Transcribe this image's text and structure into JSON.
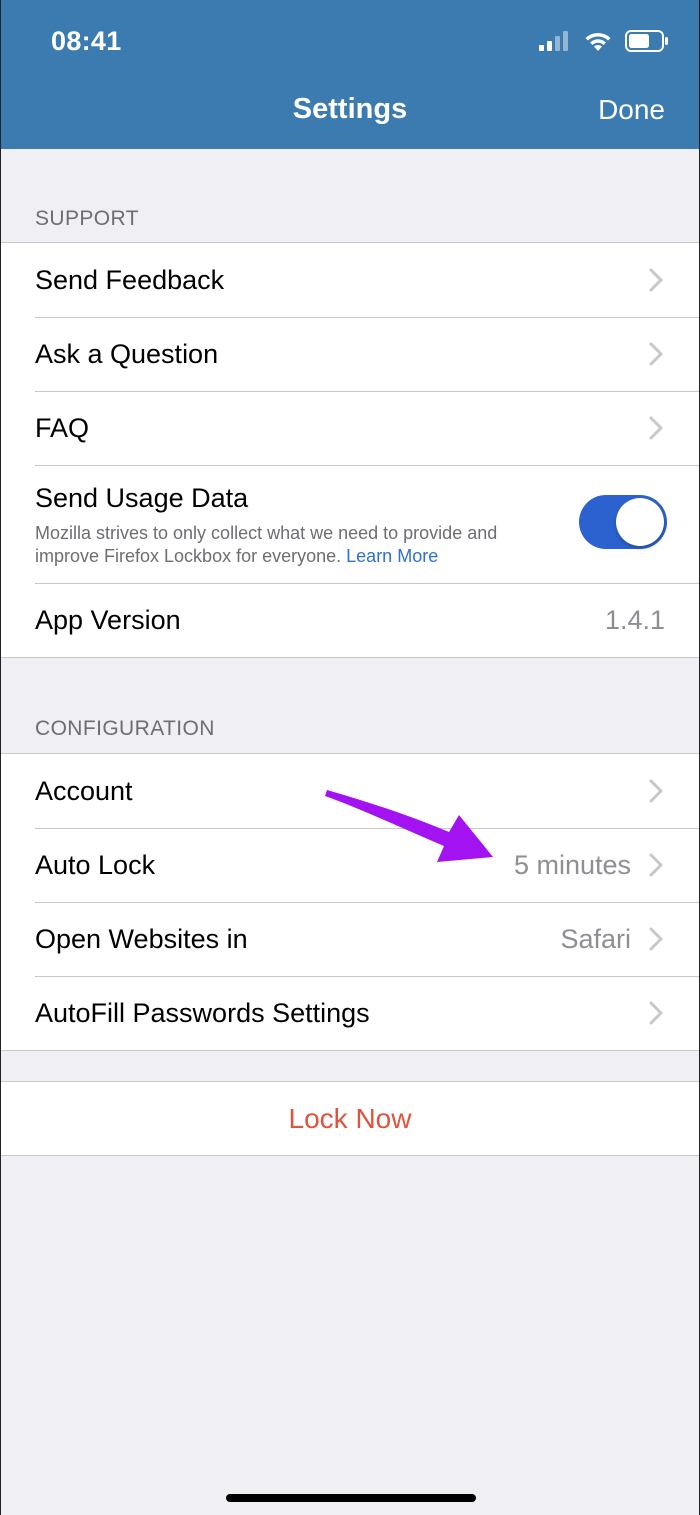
{
  "status_bar": {
    "time": "08:41",
    "icons": [
      "cellular-signal-icon",
      "wifi-icon",
      "battery-icon"
    ]
  },
  "nav": {
    "title": "Settings",
    "done_label": "Done"
  },
  "support": {
    "header": "SUPPORT",
    "send_feedback": "Send Feedback",
    "ask_question": "Ask a Question",
    "faq": "FAQ",
    "usage_title": "Send Usage Data",
    "usage_desc": "Mozilla strives to only collect what we need to provide and improve Firefox Lockbox for everyone.",
    "usage_link": "Learn More",
    "usage_enabled": true,
    "app_version_label": "App Version",
    "app_version_value": "1.4.1"
  },
  "configuration": {
    "header": "CONFIGURATION",
    "account": "Account",
    "auto_lock_label": "Auto Lock",
    "auto_lock_value": "5 minutes",
    "open_websites_label": "Open Websites in",
    "open_websites_value": "Safari",
    "autofill_label": "AutoFill Passwords Settings"
  },
  "lock_now_label": "Lock Now",
  "colors": {
    "nav_bar": "#3b7bb0",
    "toggle_on": "#2c62cf",
    "lock_now": "#e0533e",
    "annotation_arrow": "#a312f0"
  }
}
